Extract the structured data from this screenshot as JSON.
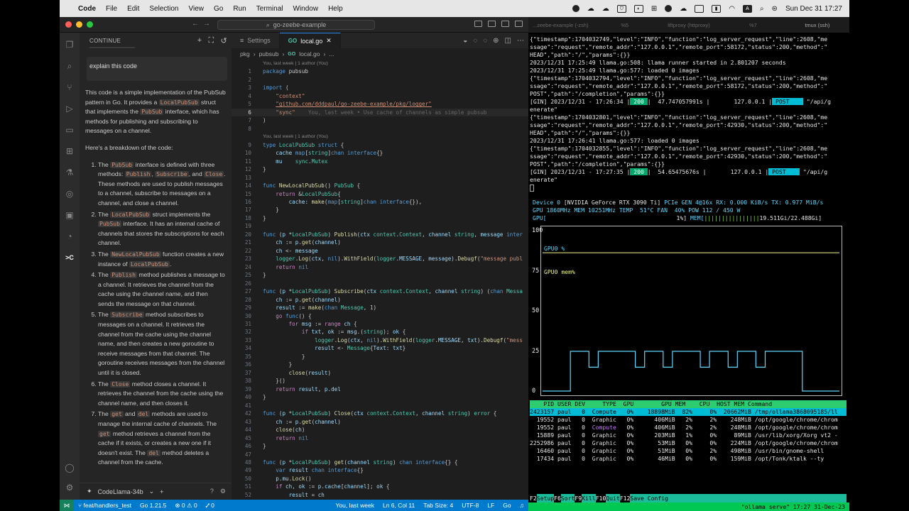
{
  "menubar": {
    "app": "Code",
    "menus": [
      "File",
      "Edit",
      "Selection",
      "View",
      "Go",
      "Run",
      "Terminal",
      "Window",
      "Help"
    ],
    "clock": "Sun Dec 31  17:27",
    "input_badge": "A"
  },
  "vscode": {
    "command_center": "go-zeebe-example",
    "sidebar": {
      "title": "CONTINUE",
      "prompt": "explain this code",
      "intro": "This code is a simple implementation of the PubSub pattern in Go. It provides a",
      "intro_code": "LocalPubSub",
      "intro_2": "struct that implements the",
      "intro_code_2": "PubSub",
      "intro_3": "interface, which has methods for publishing and subscribing to messages on a channel.",
      "breakdown": "Here's a breakdown of the code:",
      "items": [
        {
          "pre": "The",
          "code": "PubSub",
          "text": "interface is defined with three methods:",
          "code2": "Publish",
          "sep": ",",
          "code3": "Subscribe",
          "and": ", and",
          "code4": "Close",
          "rest": ". These methods are used to publish messages to a channel, subscribe to messages on a channel, and close a channel."
        },
        {
          "pre": "The",
          "code": "LocalPubSub",
          "text": "struct implements the",
          "code2": "PubSub",
          "rest": "interface. It has an internal cache of channels that stores the subscriptions for each channel."
        },
        {
          "pre": "The",
          "code": "NewLocalPubSub",
          "text": "function creates a new instance of",
          "code2": "LocalPubSub",
          "rest": "."
        },
        {
          "pre": "The",
          "code": "Publish",
          "rest": "method publishes a message to a channel. It retrieves the channel from the cache using the channel name, and then sends the message on that channel."
        },
        {
          "pre": "The",
          "code": "Subscribe",
          "rest": "method subscribes to messages on a channel. It retrieves the channel from the cache using the channel name, and then creates a new goroutine to receive messages from that channel. The goroutine receives messages from the channel until it is closed."
        },
        {
          "pre": "The",
          "code": "Close",
          "rest": "method closes a channel. It retrieves the channel from the cache using the channel name, and then closes it."
        },
        {
          "pre": "The",
          "code": "get",
          "text": "and",
          "code2": "del",
          "rest": "methods are used to manage the internal cache of channels. The",
          "code3": "get",
          "rest2": "method retrieves a channel from the cache if it exists, or creates a new one if it doesn't exist. The",
          "code4": "del",
          "rest3": "method deletes a channel from the cache."
        }
      ],
      "model": "CodeLlama-34b"
    },
    "tabs": [
      {
        "label": "Settings",
        "active": false
      },
      {
        "label": "local.go",
        "active": true
      }
    ],
    "breadcrumb": [
      "pkg",
      "pubsub",
      "local.go",
      "..."
    ],
    "blame_1": "You, last week | 1 author (You)",
    "blame_2": "You, last week | 1 author (You)",
    "inline_blame": "You, last week • Use cache of channels as simple pubsub",
    "statusbar": {
      "branch": "feat/handlers_test",
      "go_version": "Go 1.21.5",
      "problems": "⊗ 0 ⚠ 0",
      "ports": "⑇ 0",
      "blame": "You, last week",
      "position": "Ln 6, Col 11",
      "tab_size": "Tab Size: 4",
      "encoding": "UTF-8",
      "eol": "LF",
      "language": "Go"
    }
  },
  "terminal": {
    "tabs": [
      "...zeebe-example (-zsh)",
      "%5",
      "liftproxy (httproxy)",
      "%7",
      "tmux (ssh)"
    ],
    "logs": [
      "{\"timestamp\":1704032749,\"level\":\"INFO\",\"function\":\"log_server_request\",\"line\":2608,\"me",
      "ssage\":\"request\",\"remote_addr\":\"127.0.0.1\",\"remote_port\":58172,\"status\":200,\"method\":\"",
      "HEAD\",\"path\":\"/\",\"params\":{}}",
      "2023/12/31 17:25:49 llama.go:508: llama runner started in 2.801207 seconds",
      "2023/12/31 17:25:49 llama.go:577: loaded 0 images",
      "{\"timestamp\":1704032794,\"level\":\"INFO\",\"function\":\"log_server_request\",\"line\":2608,\"me",
      "ssage\":\"request\",\"remote_addr\":\"127.0.0.1\",\"remote_port\":58172,\"status\":200,\"method\":\"",
      "POST\",\"path\":\"/completion\",\"params\":{}}"
    ],
    "gin1": {
      "prefix": "[GIN] 2023/12/31 - 17:26:34 |",
      "status": " 200 ",
      "mid": "|  47.747057991s |       127.0.0.1 |",
      "method": " POST    ",
      "path": "\"/api/g"
    },
    "gin1_cont": "enerate\"",
    "logs2": [
      "{\"timestamp\":1704032801,\"level\":\"INFO\",\"function\":\"log_server_request\",\"line\":2608,\"me",
      "ssage\":\"request\",\"remote_addr\":\"127.0.0.1\",\"remote_port\":42930,\"status\":200,\"method\":\"",
      "HEAD\",\"path\":\"/\",\"params\":{}}",
      "2023/12/31 17:26:41 llama.go:577: loaded 0 images",
      "{\"timestamp\":1704032855,\"level\":\"INFO\",\"function\":\"log_server_request\",\"line\":2608,\"me",
      "ssage\":\"request\",\"remote_addr\":\"127.0.0.1\",\"remote_port\":42930,\"status\":200,\"method\":\"",
      "POST\",\"path\":\"/completion\",\"params\":{}}"
    ],
    "gin2": {
      "prefix": "[GIN] 2023/12/31 - 17:27:35 |",
      "status": " 200 ",
      "mid": "|  54.65475676s |       127.0.0.1 |",
      "method": " POST    ",
      "path": "\"/api/g"
    },
    "gin2_cont": "enerate\"",
    "nvtop": {
      "device_line_a": "Device 0 ",
      "device_line_b": "[NVIDIA GeForce RTX 3090 Ti] ",
      "pcie": "PCIe GEN 4@16x ",
      "rx": "RX: 0.000 KiB/s ",
      "tx": "TX: 0.977 MiB/s",
      "gpu_line": "GPU 1860MHz MEM 10251MHz TEMP  51°C FAN  40% POW 112 / 450 W",
      "util_label": "GPU[",
      "util_value": "1%]",
      "mem_label": " MEM[",
      "mem_bars": "||||||||||||||||",
      "mem_value": "19.511Gi/22.488Gi]",
      "legend_gpu": "GPU0 %",
      "legend_mem": "GPU0 mem%",
      "y_ticks": [
        "100",
        "75",
        "50",
        "25",
        "0"
      ]
    },
    "processes": {
      "header": "    PID USER DEV     TYPE  GPU        GPU MEM    CPU  HOST MEM Command",
      "rows": [
        {
          "pid": "2423157",
          "user": "paul",
          "dev": "0",
          "type": "Compute",
          "gpu": "0%",
          "gmem": "18898MiB",
          "gpct": "82%",
          "cpu": "0%",
          "host": "20662MiB",
          "cmd": "/tmp/ollama3868095185/ll"
        },
        {
          "pid": "19552",
          "user": "paul",
          "dev": "0",
          "type": "Graphic",
          "gpu": "0%",
          "gmem": "406MiB",
          "gpct": "2%",
          "cpu": "2%",
          "host": "248MiB",
          "cmd": "/opt/google/chrome/chrom"
        },
        {
          "pid": "19552",
          "user": "paul",
          "dev": "0",
          "type": "Compute",
          "gpu": "0%",
          "gmem": "406MiB",
          "gpct": "2%",
          "cpu": "2%",
          "host": "248MiB",
          "cmd": "/opt/google/chrome/chrom"
        },
        {
          "pid": "15889",
          "user": "paul",
          "dev": "0",
          "type": "Graphic",
          "gpu": "0%",
          "gmem": "203MiB",
          "gpct": "1%",
          "cpu": "0%",
          "host": "89MiB",
          "cmd": "/usr/lib/xorg/Xorg vt2 -"
        },
        {
          "pid": "2252986",
          "user": "paul",
          "dev": "0",
          "type": "Graphic",
          "gpu": "0%",
          "gmem": "53MiB",
          "gpct": "0%",
          "cpu": "0%",
          "host": "224MiB",
          "cmd": "/opt/google/chrome/chrom"
        },
        {
          "pid": "16460",
          "user": "paul",
          "dev": "0",
          "type": "Graphic",
          "gpu": "0%",
          "gmem": "51MiB",
          "gpct": "0%",
          "cpu": "2%",
          "host": "498MiB",
          "cmd": "/usr/bin/gnome-shell"
        },
        {
          "pid": "17434",
          "user": "paul",
          "dev": "0",
          "type": "Graphic",
          "gpu": "0%",
          "gmem": "46MiB",
          "gpct": "0%",
          "cpu": "0%",
          "host": "159MiB",
          "cmd": "/opt/Tonk/ktalk --ty"
        }
      ]
    },
    "fkeys": [
      {
        "k": "F2",
        "l": "Setup  "
      },
      {
        "k": "F6",
        "l": "Sort   "
      },
      {
        "k": "F9",
        "l": "Kill   "
      },
      {
        "k": "F10",
        "l": "Quit   "
      },
      {
        "k": "F12",
        "l": "Save Config"
      }
    ],
    "tmux_status": "\"ollama serve\" 17:27 31-Dec-23"
  },
  "chart_data": {
    "type": "line",
    "y_ticks": [
      "100",
      "75",
      "50",
      "25",
      "0"
    ],
    "ylim": [
      0,
      100
    ],
    "series": [
      {
        "name": "GPU0 %",
        "values": [
          0,
          0,
          0,
          25,
          25,
          15,
          25,
          25,
          25,
          25,
          15,
          25,
          25,
          15,
          25,
          25,
          25,
          15,
          25,
          25,
          15,
          25,
          25,
          15,
          25,
          25,
          25,
          25,
          0,
          0,
          0,
          0
        ]
      },
      {
        "name": "GPU0 mem%",
        "values": [
          87,
          87,
          87,
          87,
          87,
          87,
          87,
          87,
          87,
          87,
          87,
          87,
          87,
          87,
          87,
          87,
          87,
          87,
          87,
          87,
          87,
          87,
          87,
          87,
          87,
          87,
          87,
          87,
          87,
          87,
          87,
          87
        ]
      }
    ],
    "colors": {
      "gpu": "#5fd7ff",
      "mem": "#f1fa8c"
    }
  }
}
